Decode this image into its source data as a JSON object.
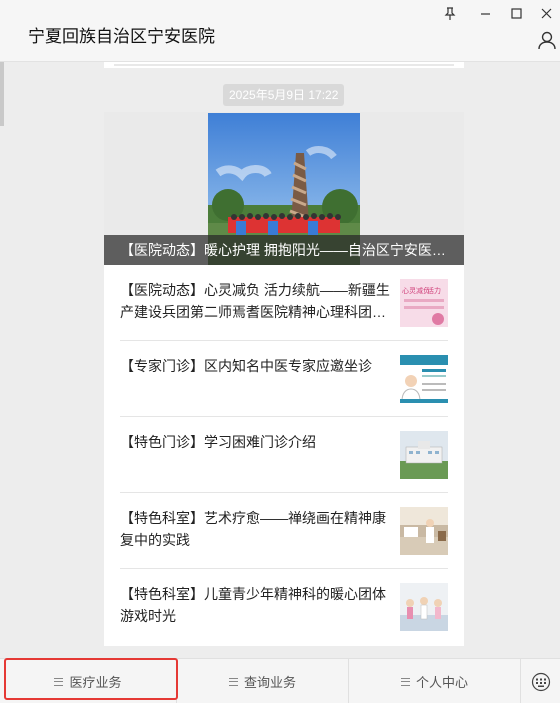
{
  "window": {
    "title": "宁夏回族自治区宁安医院"
  },
  "feed": {
    "timestamp": "2025年5月9日 17:22",
    "cover": {
      "caption": "【医院动态】暖心护理 拥抱阳光——自治区宁安医院开展活动"
    },
    "articles": [
      {
        "title": "【医院动态】心灵减负 活力续航——新疆生产建设兵团第二师焉耆医院精神心理科团队来院交流",
        "thumb": "pink-poster-thumb"
      },
      {
        "title": "【专家门诊】区内知名中医专家应邀坐诊",
        "thumb": "doctor-profile-thumb"
      },
      {
        "title": "【特色门诊】学习困难门诊介绍",
        "thumb": "building-thumb"
      },
      {
        "title": "【特色科室】艺术疗愈——禅绕画在精神康复中的实践",
        "thumb": "ward-thumb"
      },
      {
        "title": "【特色科室】儿童青少年精神科的暖心团体游戏时光",
        "thumb": "kids-activity-thumb"
      }
    ]
  },
  "bottombar": {
    "tabs": [
      {
        "label": "医疗业务"
      },
      {
        "label": "查询业务"
      },
      {
        "label": "个人中心"
      }
    ],
    "highlight_color": "#e53935"
  }
}
